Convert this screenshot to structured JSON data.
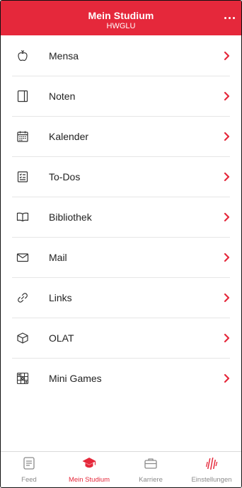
{
  "header": {
    "title": "Mein Studium",
    "subtitle": "HWGLU",
    "more_icon": "more-dots-icon"
  },
  "colors": {
    "brand": "#e5283b",
    "text": "#222222",
    "inactive": "#8a8a8a",
    "divider": "#e6e6e6"
  },
  "menu": [
    {
      "label": "Mensa",
      "icon": "apple-icon"
    },
    {
      "label": "Noten",
      "icon": "notebook-icon"
    },
    {
      "label": "Kalender",
      "icon": "calendar-icon"
    },
    {
      "label": "To-Dos",
      "icon": "checklist-icon"
    },
    {
      "label": "Bibliothek",
      "icon": "book-icon"
    },
    {
      "label": "Mail",
      "icon": "envelope-icon"
    },
    {
      "label": "Links",
      "icon": "link-icon"
    },
    {
      "label": "OLAT",
      "icon": "cube-icon"
    },
    {
      "label": "Mini Games",
      "icon": "games-icon"
    }
  ],
  "tabbar": [
    {
      "label": "Feed",
      "icon": "feed-icon",
      "active": false
    },
    {
      "label": "Mein Studium",
      "icon": "graduation-cap-icon",
      "active": true
    },
    {
      "label": "Karriere",
      "icon": "briefcase-icon",
      "active": false
    },
    {
      "label": "Einstellungen",
      "icon": "settings-logo-icon",
      "active": false
    }
  ]
}
